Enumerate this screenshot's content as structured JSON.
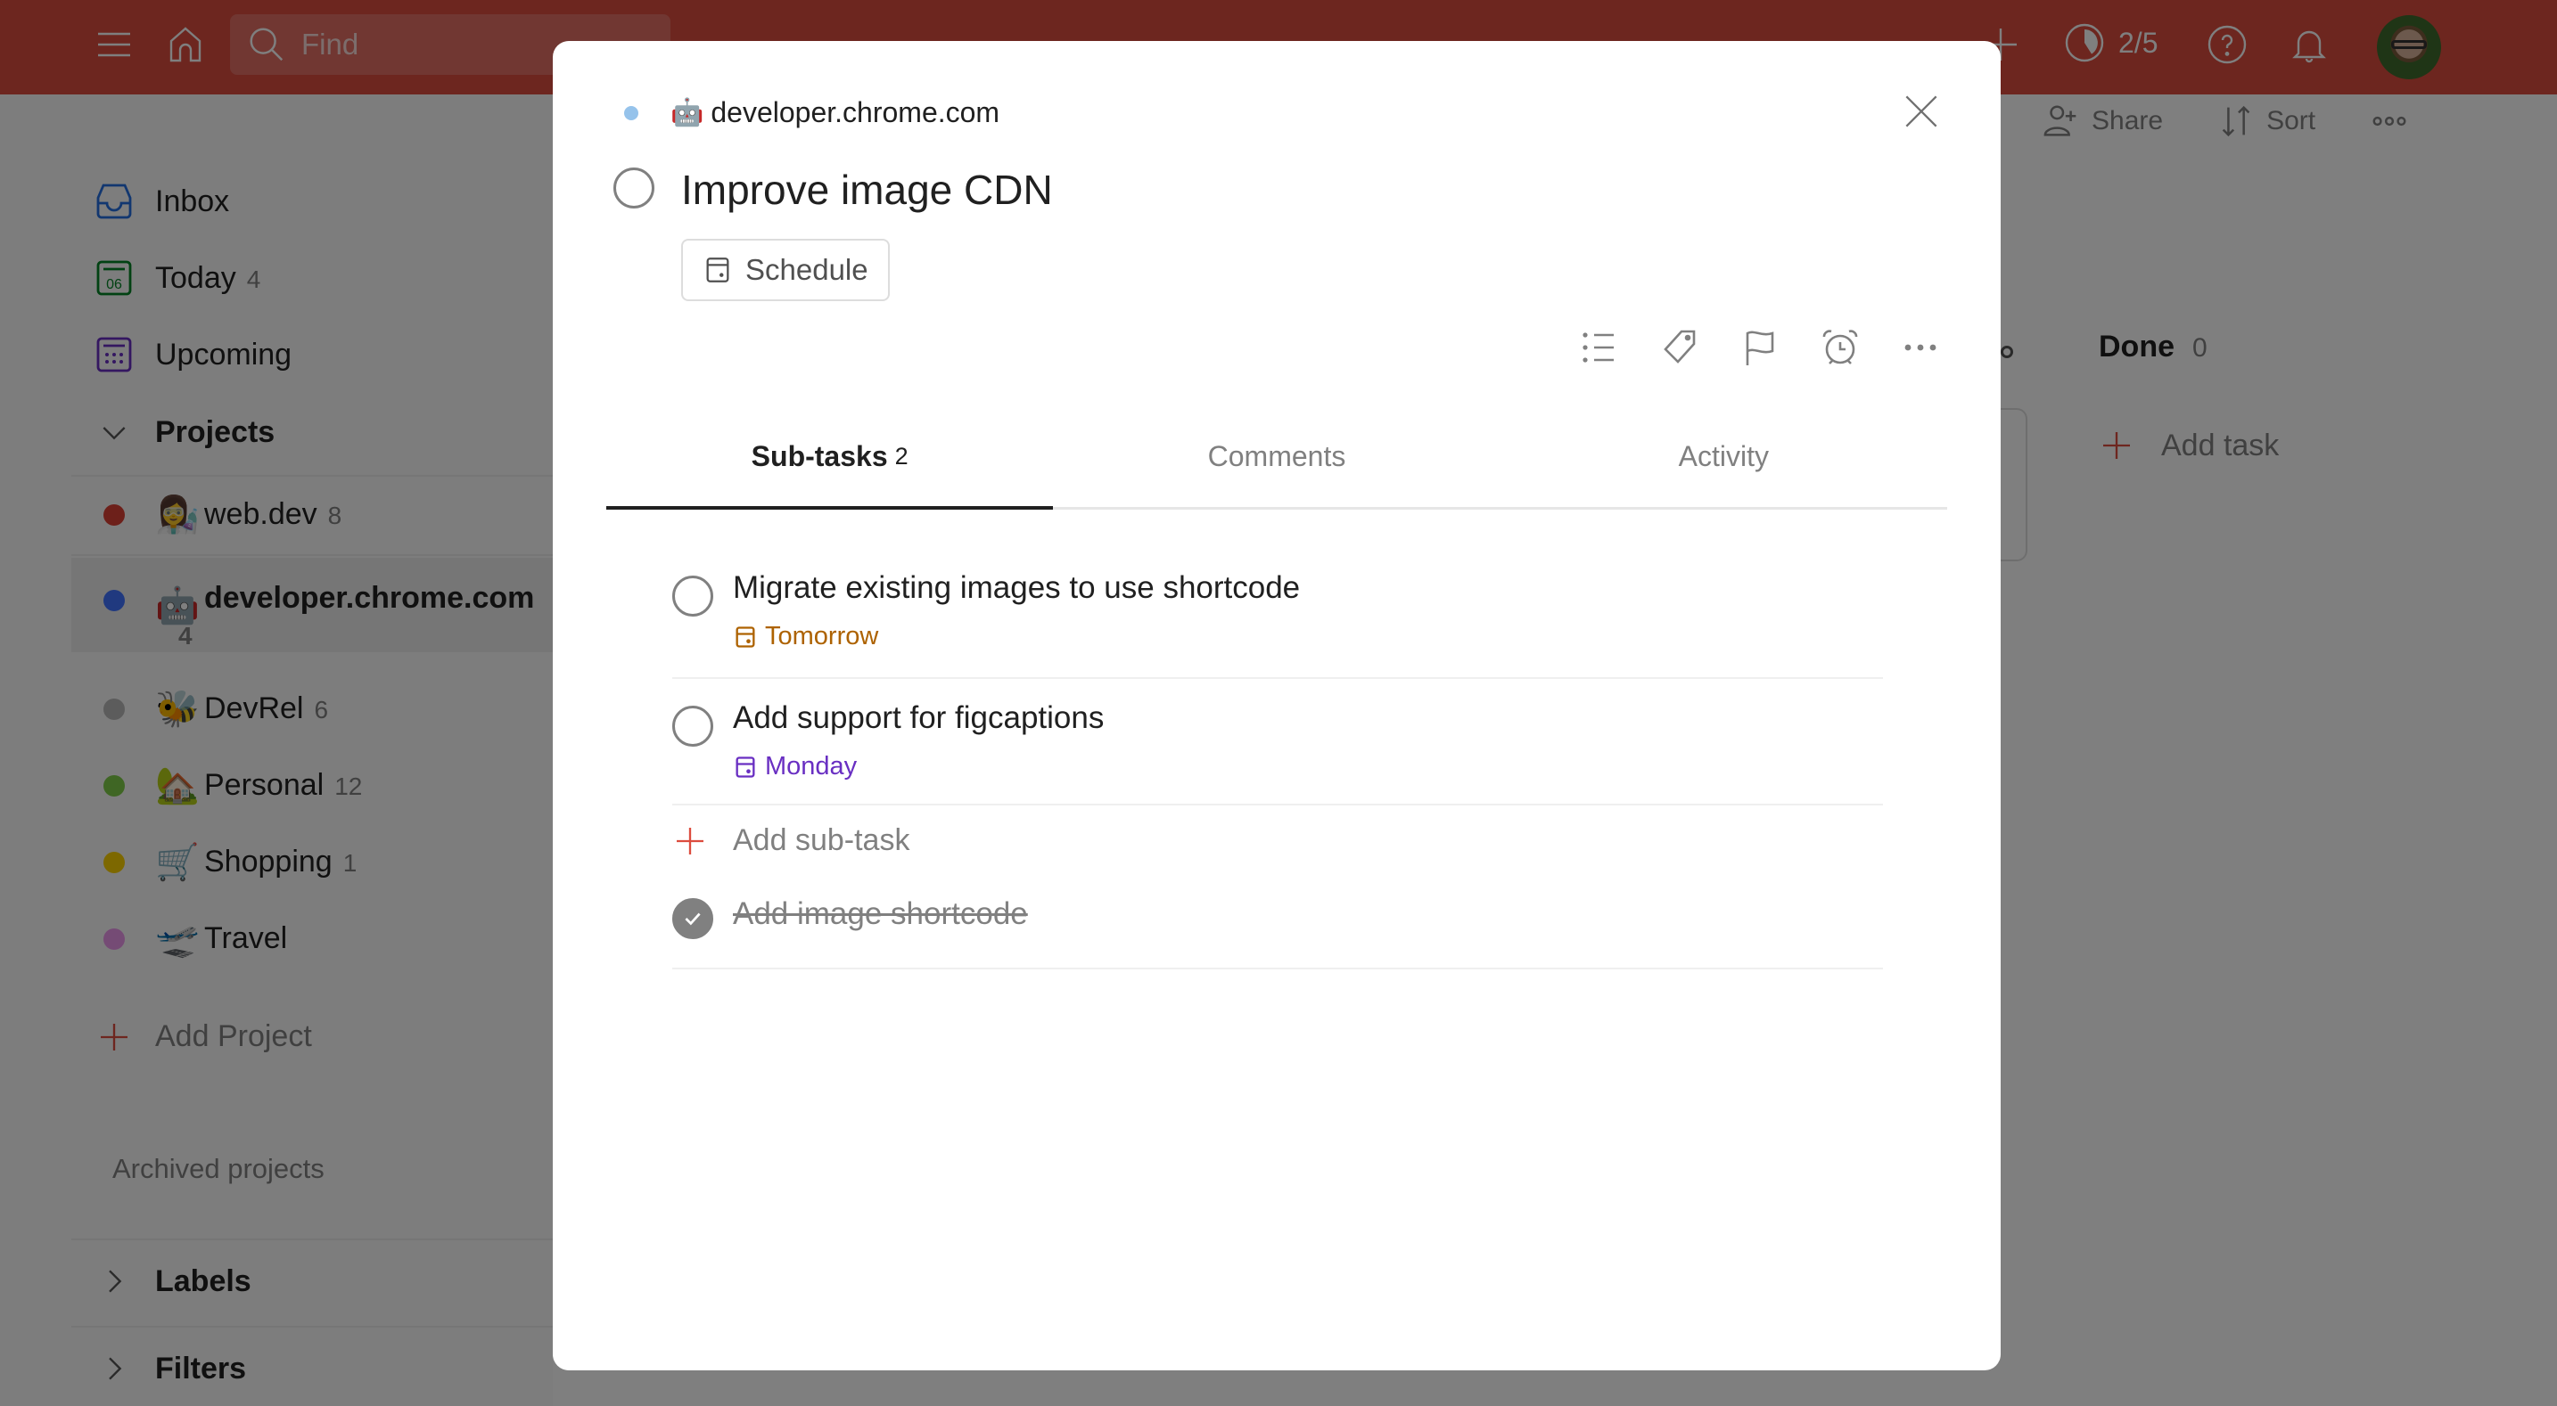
{
  "topbar": {
    "search_placeholder": "Find",
    "karma": "2/5",
    "icons": [
      "menu-icon",
      "home-icon",
      "search-icon",
      "add-icon",
      "productivity-icon",
      "help-icon",
      "notifications-icon",
      "avatar"
    ]
  },
  "sidebar": {
    "nav": [
      {
        "label": "Inbox",
        "count": "",
        "icon": "inbox-icon"
      },
      {
        "label": "Today",
        "count": "4",
        "icon": "today-calendar-icon",
        "day": "06"
      },
      {
        "label": "Upcoming",
        "count": "",
        "icon": "upcoming-calendar-icon"
      }
    ],
    "projects_header": "Projects",
    "projects": [
      {
        "name": "web.dev",
        "count": "8",
        "emoji": "👩‍🔬",
        "color": "#db4035"
      },
      {
        "name": "developer.chrome.com",
        "count": "4",
        "emoji": "🤖",
        "color": "#4073ff",
        "active": true
      },
      {
        "name": "DevRel",
        "count": "6",
        "emoji": "🐝",
        "color": "#b8b8b8"
      },
      {
        "name": "Personal",
        "count": "12",
        "emoji": "🏡",
        "color": "#7ecc49"
      },
      {
        "name": "Shopping",
        "count": "1",
        "emoji": "🛒",
        "color": "#fad000"
      },
      {
        "name": "Travel",
        "count": "",
        "emoji": "🛫",
        "color": "#eb96eb"
      }
    ],
    "add_project": "Add Project",
    "archived": "Archived projects",
    "labels_header": "Labels",
    "filters_header": "Filters"
  },
  "main": {
    "share": "Share",
    "sort": "Sort",
    "board_column": {
      "title": "Done",
      "count": "0",
      "add_task": "Add task"
    }
  },
  "modal": {
    "project_name": "developer.chrome.com",
    "project_emoji": "🤖",
    "project_color": "#96c3eb",
    "task_title": "Improve image CDN",
    "schedule_label": "Schedule",
    "toolbar": [
      "sub-task-list-icon",
      "label-tag-icon",
      "priority-flag-icon",
      "reminder-alarm-icon",
      "more-icon"
    ],
    "tabs": [
      {
        "label": "Sub-tasks",
        "count": "2",
        "active": true
      },
      {
        "label": "Comments",
        "count": ""
      },
      {
        "label": "Activity",
        "count": ""
      }
    ],
    "subtasks": [
      {
        "title": "Migrate existing images to use shortcode",
        "due": "Tomorrow",
        "due_color": "#ad6200",
        "done": false
      },
      {
        "title": "Add support for figcaptions",
        "due": "Monday",
        "due_color": "#692fc2",
        "done": false
      }
    ],
    "add_subtask": "Add sub-task",
    "completed": [
      {
        "title": "Add image shortcode",
        "done": true
      }
    ]
  },
  "colors": {
    "brand": "#db4c3f",
    "accent_red": "#dc4c3e",
    "inbox_blue": "#246fe0",
    "today_green": "#058527",
    "upcoming_purple": "#692fc2"
  }
}
